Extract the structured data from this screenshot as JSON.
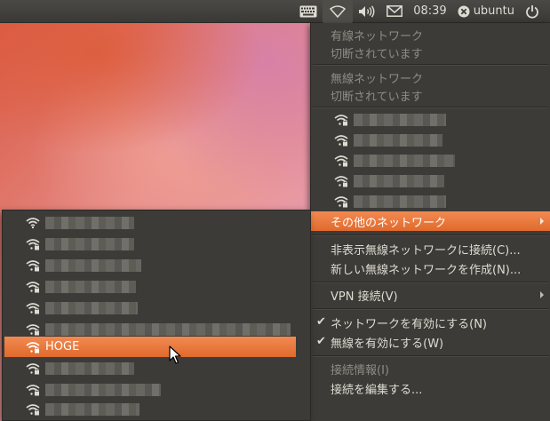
{
  "panel": {
    "clock": "08:39",
    "user": "ubuntu",
    "icons": [
      "keyboard-icon",
      "wifi-icon",
      "volume-icon",
      "mail-icon",
      "session-close-icon",
      "power-icon"
    ]
  },
  "menu": {
    "wired_header": "有線ネットワーク",
    "wired_status": "切断されています",
    "wireless_header": "無線ネットワーク",
    "wireless_status": "切断されています",
    "other_networks": "その他のネットワーク",
    "connect_hidden": "非表示無線ネットワークに接続(C)...",
    "create_new": "新しい無線ネットワークを作成(N)...",
    "vpn": "VPN 接続(V)",
    "enable_networking": "ネットワークを有効にする(N)",
    "enable_wireless": "無線を有効にする(W)",
    "connection_info": "接続情報(I)",
    "edit_connections": "接続を編集する..."
  },
  "submenu": {
    "highlighted_network": "HOGE"
  },
  "colors": {
    "accent": "#e9763c",
    "menu_bg": "#3c3b37",
    "panel_bg": "#3f3e3a"
  }
}
